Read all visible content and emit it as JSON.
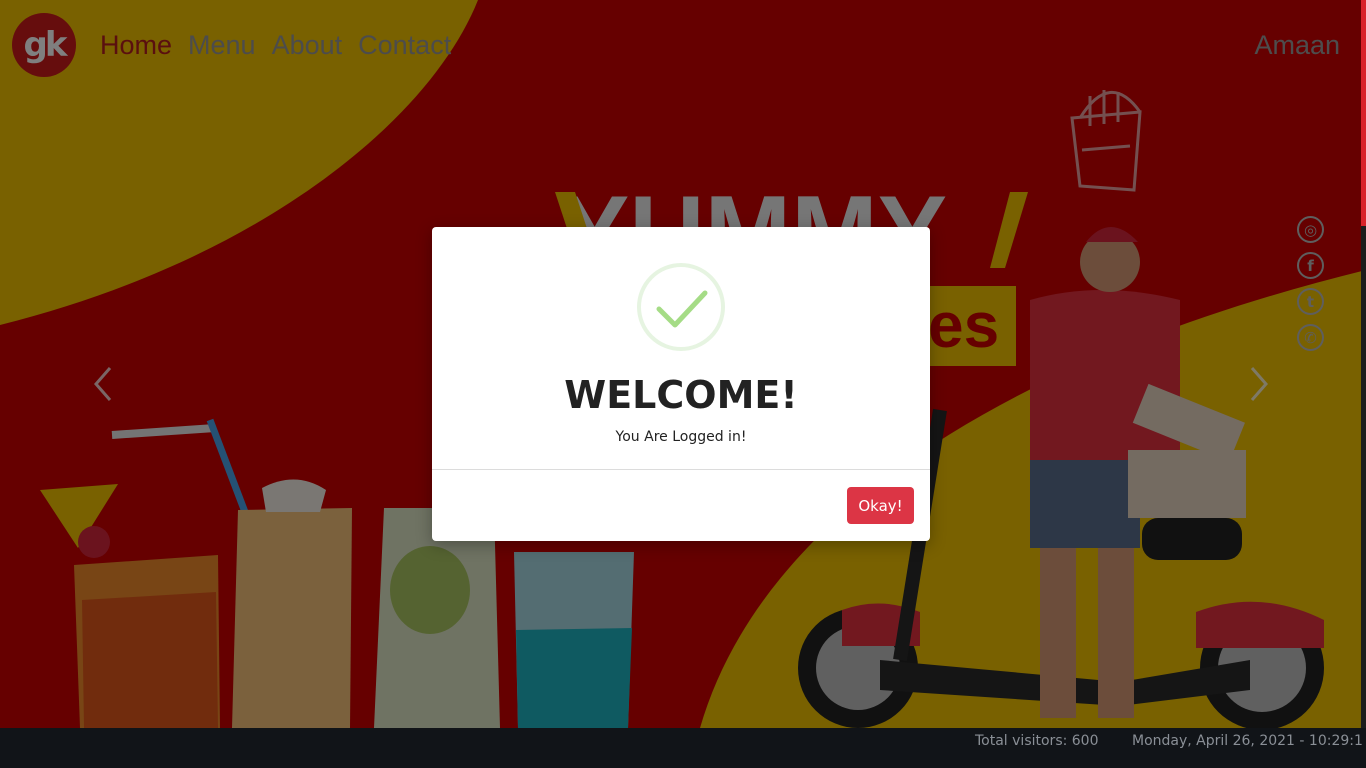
{
  "navbar": {
    "logo_text": "gk",
    "links": [
      {
        "label": "Home",
        "active": true
      },
      {
        "label": "Menu",
        "active": false
      },
      {
        "label": "About",
        "active": false
      },
      {
        "label": "Contact",
        "active": false
      }
    ],
    "user_name": "Amaan"
  },
  "hero": {
    "headline": "YUMMY",
    "headline_fragment": "es",
    "colors": {
      "primary_red": "#cc0000",
      "accent_yellow": "#f2c200"
    }
  },
  "social_icons": [
    "instagram-icon",
    "facebook-icon",
    "twitter-icon",
    "whatsapp-icon"
  ],
  "modal": {
    "title": "WELCOME!",
    "message": "You Are Logged in!",
    "button_label": "Okay!",
    "button_color": "#dc3545",
    "check_color": "#a5dc86"
  },
  "footer": {
    "visitors": "Total visitors: 600",
    "datetime": "Monday, April 26, 2021 - 10:29:1"
  }
}
